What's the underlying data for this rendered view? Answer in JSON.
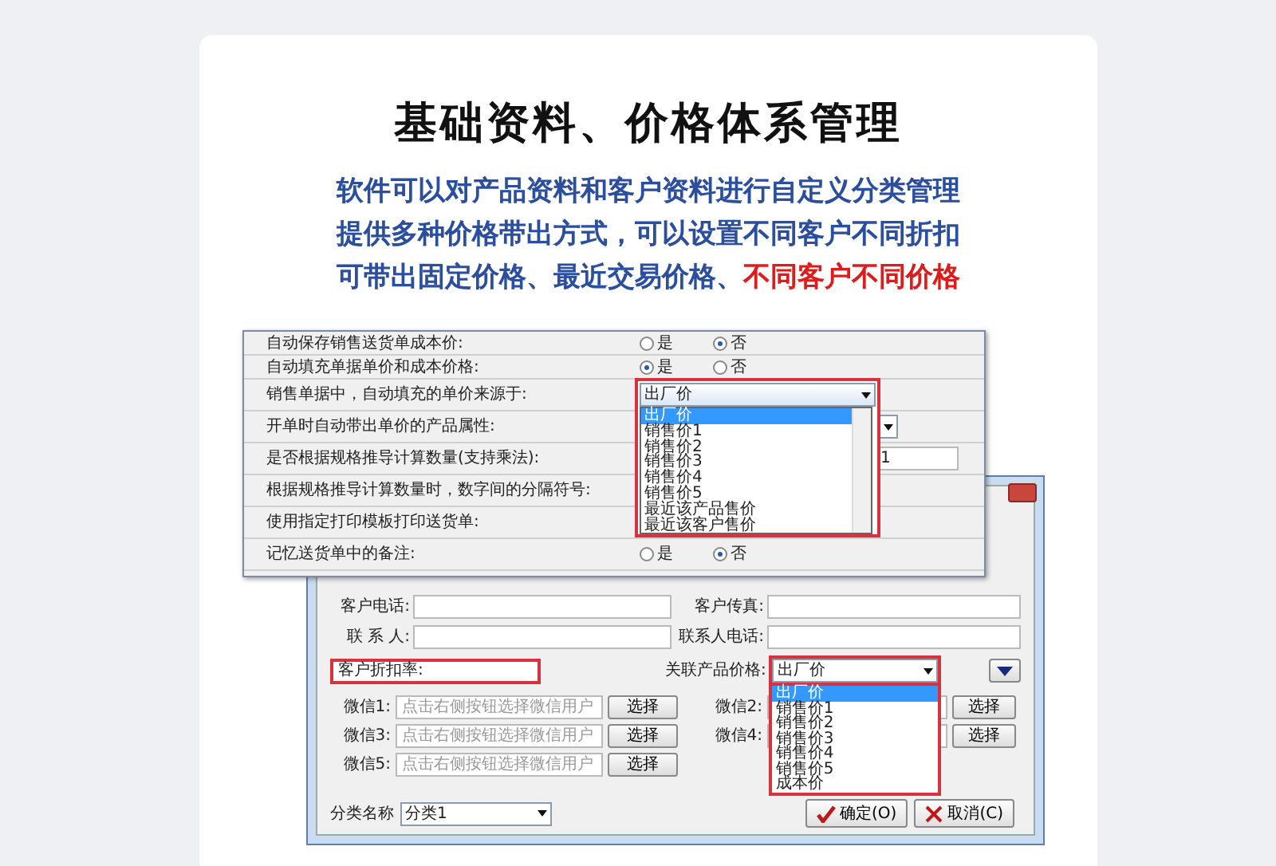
{
  "heading": "基础资料、价格体系管理",
  "tagline": [
    {
      "parts": [
        {
          "text": "软件可以对产品资料和客户资料进行自定义分类管理",
          "highlight": false
        }
      ]
    },
    {
      "parts": [
        {
          "text": "提供多种价格带出方式，可以设置不同客户不同折扣",
          "highlight": false
        }
      ]
    },
    {
      "parts": [
        {
          "text": "可带出固定价格、最近交易价格、",
          "highlight": false
        },
        {
          "text": "不同客户不同价格",
          "highlight": true
        }
      ]
    }
  ],
  "settings_window": {
    "rows": [
      {
        "label": "自动保存销售送货单成本价:",
        "kind": "radio",
        "options": [
          {
            "label": "是",
            "selected": false
          },
          {
            "label": "否",
            "selected": true
          }
        ]
      },
      {
        "label": "自动填充单据单价和成本价格:",
        "kind": "radio",
        "options": [
          {
            "label": "是",
            "selected": true
          },
          {
            "label": "否",
            "selected": false
          }
        ]
      },
      {
        "label": "销售单据中，自动填充的单价来源于:",
        "kind": "blank"
      },
      {
        "label": "开单时自动带出单价的产品属性:",
        "kind": "combo"
      },
      {
        "label": "是否根据规格推导计算数量(支持乘法):",
        "kind": "field",
        "value": "1"
      },
      {
        "label": "根据规格推导计算数量时，数字间的分隔符号:",
        "kind": "blank"
      },
      {
        "label": "使用指定打印模板打印送货单:",
        "kind": "blank"
      },
      {
        "label": "记忆送货单中的备注:",
        "kind": "radio",
        "options": [
          {
            "label": "是",
            "selected": false
          },
          {
            "label": "否",
            "selected": true
          }
        ]
      }
    ],
    "price_source": {
      "value": "出厂价",
      "items": [
        {
          "label": "出厂价",
          "selected": true
        },
        {
          "label": "销售价1",
          "selected": false
        },
        {
          "label": "销售价2",
          "selected": false
        },
        {
          "label": "销售价3",
          "selected": false
        },
        {
          "label": "销售价4",
          "selected": false
        },
        {
          "label": "销售价5",
          "selected": false
        },
        {
          "label": "最近该产品售价",
          "selected": false
        },
        {
          "label": "最近该客户售价",
          "selected": false
        }
      ]
    }
  },
  "customer_window": {
    "fields": [
      {
        "label": "客户电话:"
      },
      {
        "label": "客户传真:"
      },
      {
        "label": "联 系 人:"
      },
      {
        "label": "联系人电话:"
      }
    ],
    "discount": {
      "label": "客户折扣率:"
    },
    "price_link": {
      "label": "关联产品价格:",
      "value": "出厂价",
      "items": [
        {
          "label": "出厂价",
          "selected": true
        },
        {
          "label": "销售价1",
          "selected": false
        },
        {
          "label": "销售价2",
          "selected": false
        },
        {
          "label": "销售价3",
          "selected": false
        },
        {
          "label": "销售价4",
          "selected": false
        },
        {
          "label": "销售价5",
          "selected": false
        },
        {
          "label": "成本价",
          "selected": false
        }
      ]
    },
    "wechat": [
      {
        "label": "微信1:",
        "placeholder": "点击右侧按钮选择微信用户",
        "button": "选择"
      },
      {
        "label": "微信2:",
        "button": "选择"
      },
      {
        "label": "微信3:",
        "placeholder": "点击右侧按钮选择微信用户",
        "button": "选择"
      },
      {
        "label": "微信4:",
        "button": "选择"
      },
      {
        "label": "微信5:",
        "placeholder": "点击右侧按钮选择微信用户",
        "button": "选择"
      }
    ],
    "category": {
      "label": "分类名称",
      "value": "分类1"
    },
    "buttons": [
      {
        "label": "确定(O)",
        "kind": "ok"
      },
      {
        "label": "取消(C)",
        "kind": "cancel"
      }
    ]
  }
}
